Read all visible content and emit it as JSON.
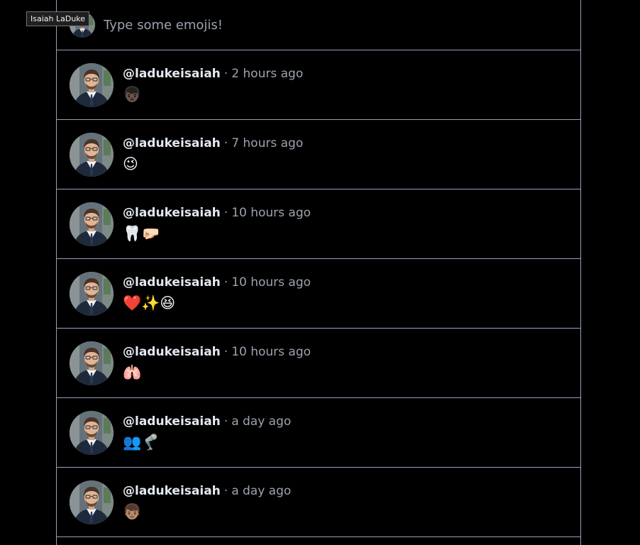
{
  "tooltip": {
    "text": "Isaiah LaDuke"
  },
  "composer": {
    "placeholder": "Type some emojis!"
  },
  "posts": [
    {
      "username": "@ladukeisaiah",
      "separator": "·",
      "time": "2 hours ago",
      "content": "👦🏿"
    },
    {
      "username": "@ladukeisaiah",
      "separator": "·",
      "time": "7 hours ago",
      "content": "😉"
    },
    {
      "username": "@ladukeisaiah",
      "separator": "·",
      "time": "10 hours ago",
      "content": "🦷🤛🏻"
    },
    {
      "username": "@ladukeisaiah",
      "separator": "·",
      "time": "10 hours ago",
      "content": "❤️✨😆"
    },
    {
      "username": "@ladukeisaiah",
      "separator": "·",
      "time": "10 hours ago",
      "content": "🫁"
    },
    {
      "username": "@ladukeisaiah",
      "separator": "·",
      "time": "a day ago",
      "content": "👥🦿"
    },
    {
      "username": "@ladukeisaiah",
      "separator": "·",
      "time": "a day ago",
      "content": "👦🏽"
    }
  ]
}
